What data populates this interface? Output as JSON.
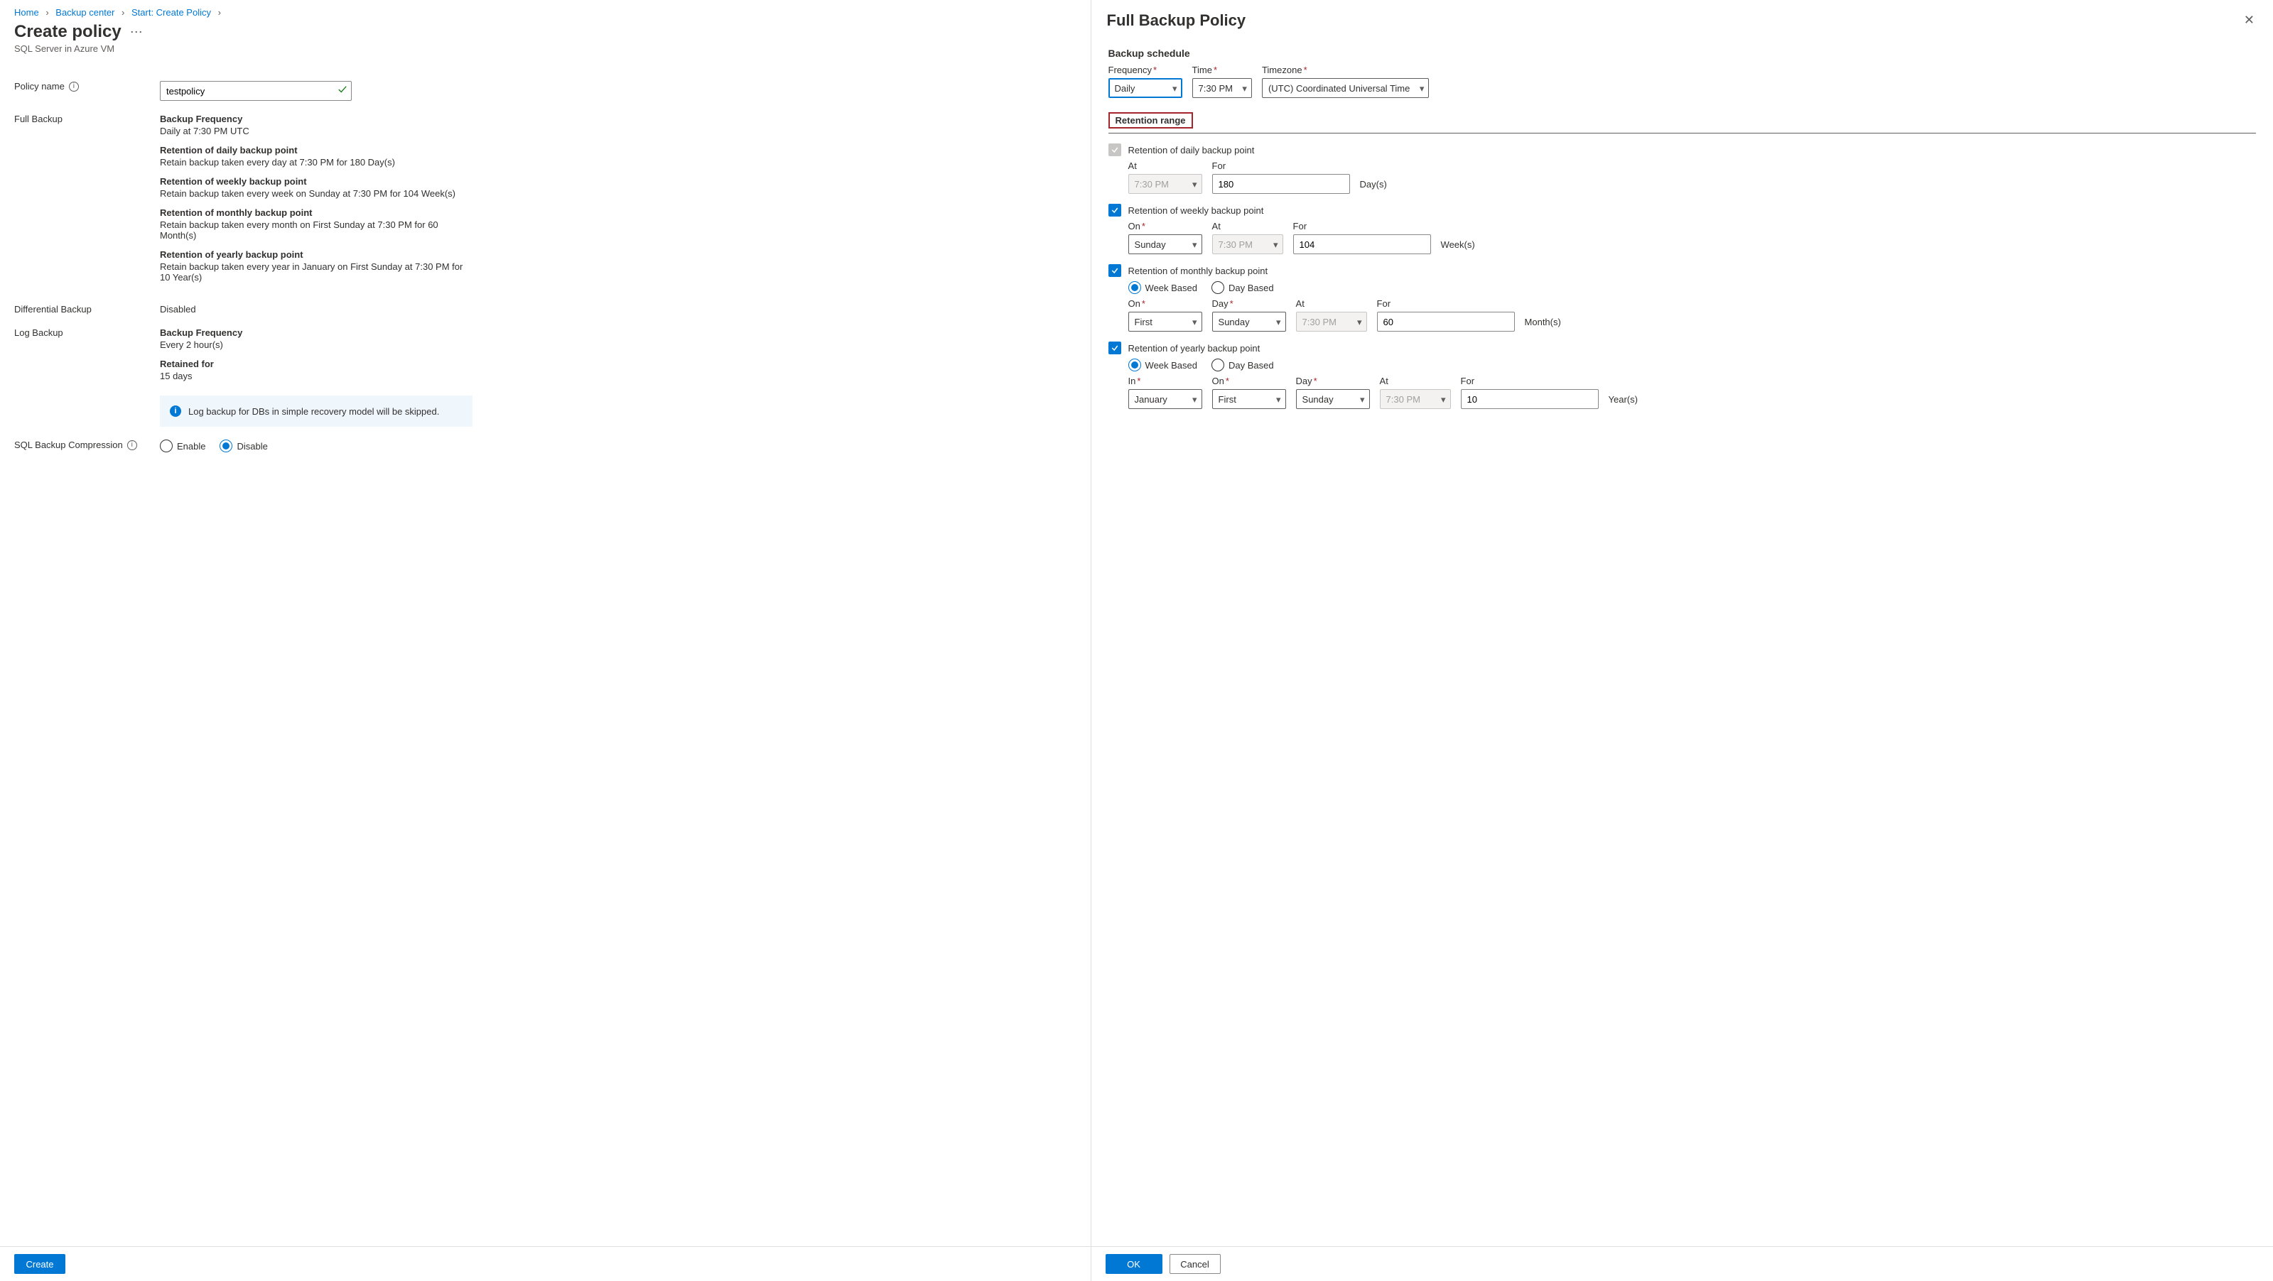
{
  "breadcrumb": {
    "items": [
      {
        "label": "Home"
      },
      {
        "label": "Backup center"
      },
      {
        "label": "Start: Create Policy"
      }
    ]
  },
  "page": {
    "title": "Create policy",
    "subtitle": "SQL Server in Azure VM"
  },
  "policy_name": {
    "label": "Policy name",
    "value": "testpolicy"
  },
  "full_backup": {
    "label": "Full Backup",
    "freq_h": "Backup Frequency",
    "freq_v": "Daily at 7:30 PM UTC",
    "daily_h": "Retention of daily backup point",
    "daily_v": "Retain backup taken every day at 7:30 PM for 180 Day(s)",
    "weekly_h": "Retention of weekly backup point",
    "weekly_v": "Retain backup taken every week on Sunday at 7:30 PM for 104 Week(s)",
    "monthly_h": "Retention of monthly backup point",
    "monthly_v": "Retain backup taken every month on First Sunday at 7:30 PM for 60 Month(s)",
    "yearly_h": "Retention of yearly backup point",
    "yearly_v": "Retain backup taken every year in January on First Sunday at 7:30 PM for 10 Year(s)"
  },
  "diff_backup": {
    "label": "Differential Backup",
    "value": "Disabled"
  },
  "log_backup": {
    "label": "Log Backup",
    "freq_h": "Backup Frequency",
    "freq_v": "Every 2 hour(s)",
    "ret_h": "Retained for",
    "ret_v": "15 days",
    "info": "Log backup for DBs in simple recovery model will be skipped."
  },
  "compression": {
    "label": "SQL Backup Compression",
    "enable": "Enable",
    "disable": "Disable"
  },
  "footer": {
    "create": "Create"
  },
  "panel": {
    "title": "Full Backup Policy",
    "schedule_h": "Backup schedule",
    "freq_l": "Frequency",
    "freq_v": "Daily",
    "time_l": "Time",
    "time_v": "7:30 PM",
    "tz_l": "Timezone",
    "tz_v": "(UTC) Coordinated Universal Time",
    "retention_h": "Retention range",
    "daily": {
      "label": "Retention of daily backup point",
      "at_l": "At",
      "at_v": "7:30 PM",
      "for_l": "For",
      "for_v": "180",
      "unit": "Day(s)"
    },
    "weekly": {
      "label": "Retention of weekly backup point",
      "on_l": "On",
      "on_v": "Sunday",
      "at_l": "At",
      "at_v": "7:30 PM",
      "for_l": "For",
      "for_v": "104",
      "unit": "Week(s)"
    },
    "monthly": {
      "label": "Retention of monthly backup point",
      "wb": "Week Based",
      "db": "Day Based",
      "on_l": "On",
      "on_v": "First",
      "day_l": "Day",
      "day_v": "Sunday",
      "at_l": "At",
      "at_v": "7:30 PM",
      "for_l": "For",
      "for_v": "60",
      "unit": "Month(s)"
    },
    "yearly": {
      "label": "Retention of yearly backup point",
      "wb": "Week Based",
      "db": "Day Based",
      "in_l": "In",
      "in_v": "January",
      "on_l": "On",
      "on_v": "First",
      "day_l": "Day",
      "day_v": "Sunday",
      "at_l": "At",
      "at_v": "7:30 PM",
      "for_l": "For",
      "for_v": "10",
      "unit": "Year(s)"
    },
    "ok": "OK",
    "cancel": "Cancel"
  }
}
